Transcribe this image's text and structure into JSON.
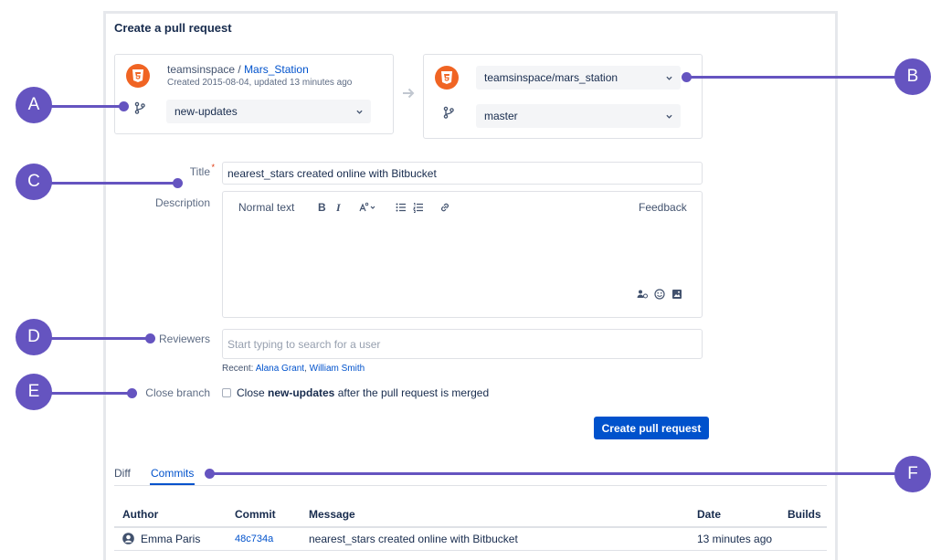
{
  "page_title": "Create a pull request",
  "source": {
    "repo_owner": "teamsinspace",
    "separator": " / ",
    "repo_name": "Mars_Station",
    "meta": "Created 2015-08-04, updated 13 minutes ago",
    "branch": "new-updates"
  },
  "destination": {
    "repo": "teamsinspace/mars_station",
    "branch": "master"
  },
  "form": {
    "title_label": "Title",
    "required_mark": "*",
    "title_value": "nearest_stars created online with Bitbucket",
    "description_label": "Description",
    "toolbar": {
      "text_style": "Normal text",
      "bold": "B",
      "italic": "I",
      "feedback": "Feedback"
    },
    "reviewers_label": "Reviewers",
    "reviewers_placeholder": "Start typing to search for a user",
    "recent_label": "Recent:",
    "recent_users": [
      "Alana Grant",
      "William Smith"
    ],
    "close_branch_label": "Close branch",
    "close_text_before": "Close ",
    "close_text_branch": "new-updates",
    "close_text_after": " after the pull request is merged",
    "submit_label": "Create pull request"
  },
  "tabs": [
    {
      "label": "Diff",
      "active": false
    },
    {
      "label": "Commits",
      "active": true
    }
  ],
  "commits_table": {
    "headers": [
      "Author",
      "Commit",
      "Message",
      "Date",
      "Builds"
    ],
    "rows": [
      {
        "author": "Emma Paris",
        "commit": "48c734a",
        "message": "nearest_stars created online with Bitbucket",
        "date": "13 minutes ago",
        "builds": ""
      }
    ]
  },
  "callouts": [
    "A",
    "B",
    "C",
    "D",
    "E",
    "F"
  ],
  "colors": {
    "accent": "#0052cc",
    "callout": "#6554c0",
    "repo_avatar": "#f06423"
  }
}
